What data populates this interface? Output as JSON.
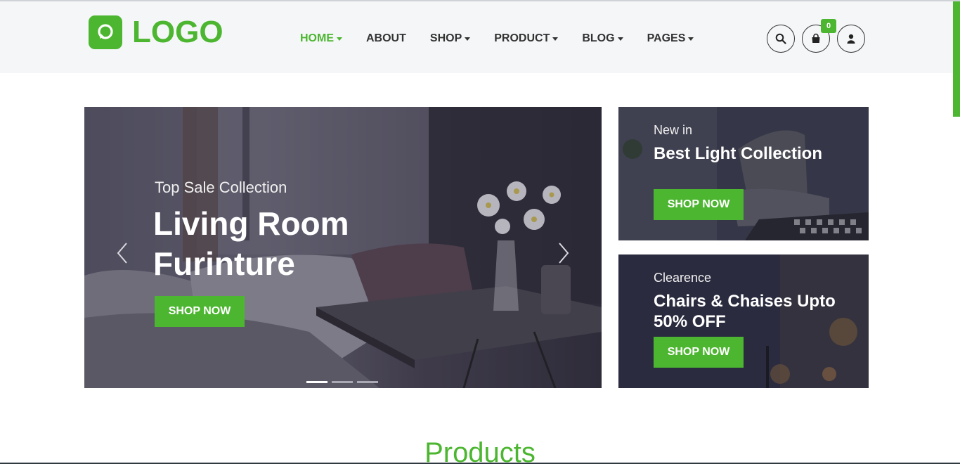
{
  "header": {
    "logo_text": "LOGO",
    "nav": [
      {
        "label": "HOME",
        "dropdown": true,
        "active": true
      },
      {
        "label": "ABOUT",
        "dropdown": false,
        "active": false
      },
      {
        "label": "SHOP",
        "dropdown": true,
        "active": false
      },
      {
        "label": "PRODUCT",
        "dropdown": true,
        "active": false
      },
      {
        "label": "BLOG",
        "dropdown": true,
        "active": false
      },
      {
        "label": "PAGES",
        "dropdown": true,
        "active": false
      }
    ],
    "icons": [
      "search-icon",
      "shopping-bag-icon",
      "user-icon"
    ],
    "cart_count": "0"
  },
  "hero": {
    "subtitle": "Top Sale Collection",
    "title": "Living Room Furinture",
    "button_label": "SHOP NOW",
    "slides": 3,
    "active_slide": 1
  },
  "banners": [
    {
      "subtitle": "New in",
      "title": "Best Light Collection",
      "button_label": "SHOP NOW"
    },
    {
      "subtitle": "Clearence",
      "title": "Chairs & Chaises Upto 50% OFF",
      "button_label": "SHOP NOW"
    }
  ],
  "products": {
    "section_title": "Products"
  },
  "colors": {
    "accent": "#4cb630",
    "header_bg": "#f5f6f8",
    "text_dark": "#333333"
  }
}
